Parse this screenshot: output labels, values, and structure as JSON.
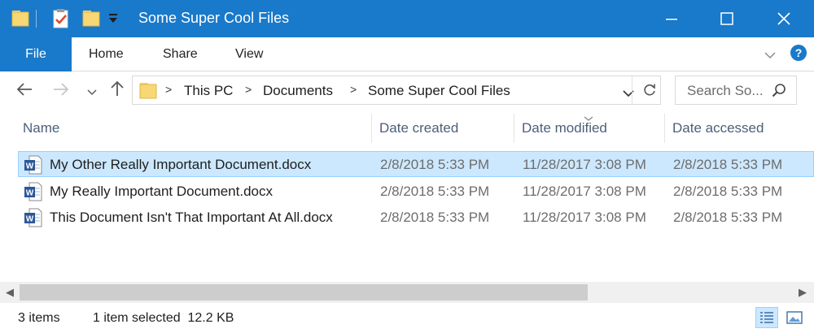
{
  "window": {
    "title": "Some Super Cool Files",
    "accent": "#1979ca"
  },
  "ribbon": {
    "tabs": [
      {
        "label": "File"
      },
      {
        "label": "Home"
      },
      {
        "label": "Share"
      },
      {
        "label": "View"
      }
    ]
  },
  "address": {
    "crumbs": [
      "This PC",
      "Documents",
      "Some Super Cool Files"
    ]
  },
  "search": {
    "placeholder": "Search So..."
  },
  "columns": [
    {
      "label": "Name"
    },
    {
      "label": "Date created"
    },
    {
      "label": "Date modified"
    },
    {
      "label": "Date accessed"
    }
  ],
  "files": [
    {
      "name": "My Other Really Important Document.docx",
      "created": "2/8/2018 5:33 PM",
      "modified": "11/28/2017 3:08 PM",
      "accessed": "2/8/2018 5:33 PM",
      "selected": true
    },
    {
      "name": "My Really Important Document.docx",
      "created": "2/8/2018 5:33 PM",
      "modified": "11/28/2017 3:08 PM",
      "accessed": "2/8/2018 5:33 PM",
      "selected": false
    },
    {
      "name": "This Document Isn't That Important At All.docx",
      "created": "2/8/2018 5:33 PM",
      "modified": "11/28/2017 3:08 PM",
      "accessed": "2/8/2018 5:33 PM",
      "selected": false
    }
  ],
  "status": {
    "item_count": "3 items",
    "selection": "1 item selected  12.2 KB"
  }
}
